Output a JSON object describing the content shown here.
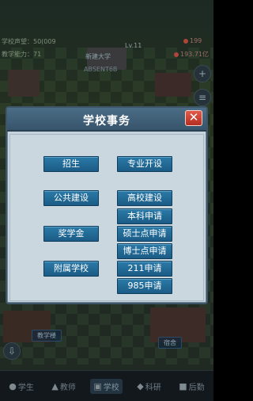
{
  "hud": {
    "reputation": "学校声望：50(009",
    "education_power": "教学能力：71",
    "school_name": "新建大学",
    "school_level_tag": "ABSENT6B",
    "lv": "Lv.11",
    "badge_top": "199",
    "badge_bottom": "193.71亿"
  },
  "map": {
    "labels": [
      "教学楼",
      "宿舍"
    ]
  },
  "modal": {
    "title": "学校事务",
    "close_symbol": "✕",
    "left_buttons": [
      "招生",
      "公共建设",
      "奖学金",
      "附属学校"
    ],
    "top_right_button": "专业开设",
    "right_buttons": [
      "高校建设",
      "本科申请",
      "硕士点申请",
      "博士点申请",
      "211申请",
      "985申请"
    ]
  },
  "bottom_nav": {
    "tabs": [
      {
        "label": "学生",
        "icon": "student-icon"
      },
      {
        "label": "教师",
        "icon": "teacher-icon"
      },
      {
        "label": "学校",
        "icon": "school-icon"
      },
      {
        "label": "科研",
        "icon": "research-icon"
      },
      {
        "label": "后勤",
        "icon": "logistics-icon"
      }
    ]
  },
  "colors": {
    "modal_header": "#3f5e76",
    "button_blue": "#2369a0",
    "close_red": "#c23a2d"
  }
}
